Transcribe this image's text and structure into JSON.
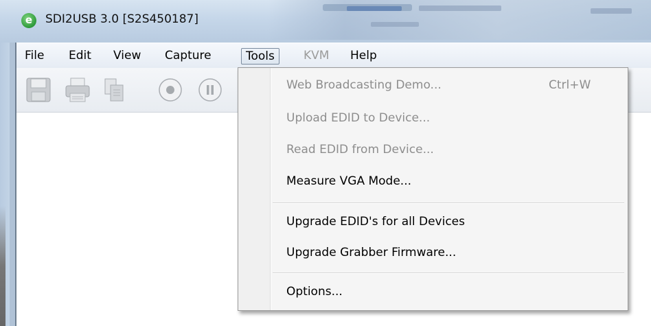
{
  "window": {
    "title": "SDI2USB 3.0 [S2S450187]",
    "app_icon": "app-logo-icon",
    "app_icon_glyph": "e"
  },
  "menubar": {
    "items": [
      {
        "label": "File",
        "state": "normal"
      },
      {
        "label": "Edit",
        "state": "normal"
      },
      {
        "label": "View",
        "state": "normal"
      },
      {
        "label": "Capture",
        "state": "normal"
      },
      {
        "label": "Tools",
        "state": "active"
      },
      {
        "label": "KVM",
        "state": "disabled"
      },
      {
        "label": "Help",
        "state": "normal"
      }
    ]
  },
  "toolbar": {
    "buttons": [
      {
        "icon": "save-icon",
        "enabled": false
      },
      {
        "icon": "print-icon",
        "enabled": false
      },
      {
        "icon": "copy-icon",
        "enabled": false
      },
      {
        "icon": "record-icon",
        "enabled": false
      },
      {
        "icon": "pause-icon",
        "enabled": false
      }
    ]
  },
  "tools_menu": {
    "items": [
      {
        "label": "Web Broadcasting Demo...",
        "shortcut": "Ctrl+W",
        "enabled": false
      },
      {
        "label": "Upload EDID to Device...",
        "enabled": false
      },
      {
        "label": "Read EDID from Device...",
        "enabled": false
      },
      {
        "label": "Measure VGA Mode...",
        "enabled": true
      },
      {
        "label": "Upgrade EDID's for all Devices",
        "enabled": true
      },
      {
        "label": "Upgrade Grabber Firmware...",
        "enabled": true
      },
      {
        "label": "Options...",
        "enabled": true
      }
    ]
  },
  "colors": {
    "disabled_text": "#8d8d8d",
    "menu_background": "#f5f5f5",
    "titlebar": "#c5d6e9"
  }
}
